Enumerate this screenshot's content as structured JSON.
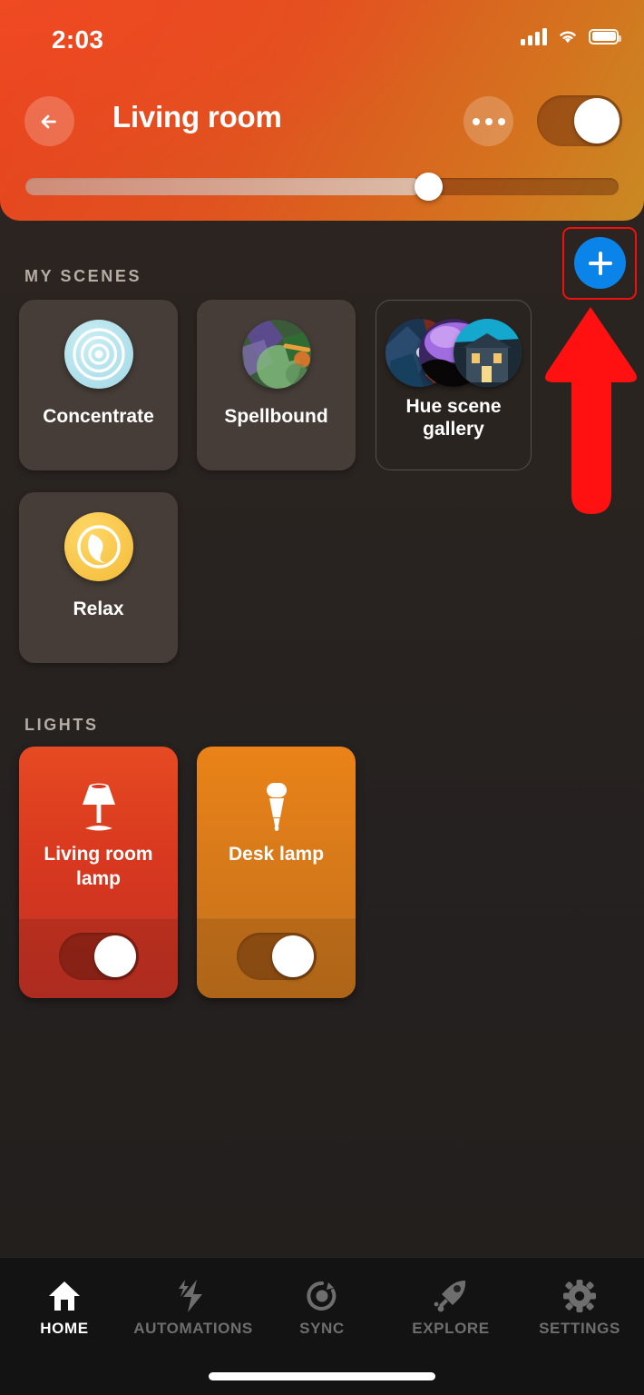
{
  "status_bar": {
    "time": "2:03",
    "cellular_icon": "cellular-bars-icon",
    "wifi_icon": "wifi-icon",
    "battery_icon": "battery-icon"
  },
  "header": {
    "title": "Living room",
    "back_icon": "back-arrow-icon",
    "more_icon": "more-options-icon",
    "room_power_on": true,
    "brightness_percent": 68,
    "gradient_from": "#E8421F",
    "gradient_to": "#C98A23"
  },
  "annotation": {
    "highlight_color": "#F01010",
    "arrow_color": "#FF1111",
    "target": "add-scene-button"
  },
  "add_button": {
    "icon": "plus-icon",
    "color": "#0A84E8"
  },
  "scenes": {
    "section_label": "MY SCENES",
    "items": [
      {
        "name": "Concentrate",
        "thumb_type": "icon",
        "icon": "concentrate-rings-icon",
        "accent": "#A9DEE8",
        "outlined": false
      },
      {
        "name": "Spellbound",
        "thumb_type": "image",
        "icon": "spellbound-thumbnail",
        "accent": "#5E8A52",
        "outlined": false
      },
      {
        "name": "Hue scene gallery",
        "thumb_type": "gallery",
        "icon": "scene-gallery-thumbnails",
        "accent": "#3B5E7A",
        "outlined": true
      },
      {
        "name": "Relax",
        "thumb_type": "icon",
        "icon": "relax-moon-icon",
        "accent": "#F5C043",
        "outlined": false
      }
    ]
  },
  "lights": {
    "section_label": "LIGHTS",
    "items": [
      {
        "name": "Living room lamp",
        "icon": "table-lamp-icon",
        "on": true,
        "color_top": "#E34420",
        "color_bottom": "#C03225"
      },
      {
        "name": "Desk lamp",
        "icon": "bulb-spot-icon",
        "on": true,
        "color_top": "#E8801A",
        "color_bottom": "#C2751B"
      }
    ]
  },
  "bottom_nav": {
    "active": "HOME",
    "items": [
      {
        "label": "HOME",
        "icon": "home-icon"
      },
      {
        "label": "AUTOMATIONS",
        "icon": "lightning-bolt-icon"
      },
      {
        "label": "SYNC",
        "icon": "sync-icon"
      },
      {
        "label": "EXPLORE",
        "icon": "rocket-icon"
      },
      {
        "label": "SETTINGS",
        "icon": "gear-icon"
      }
    ]
  }
}
